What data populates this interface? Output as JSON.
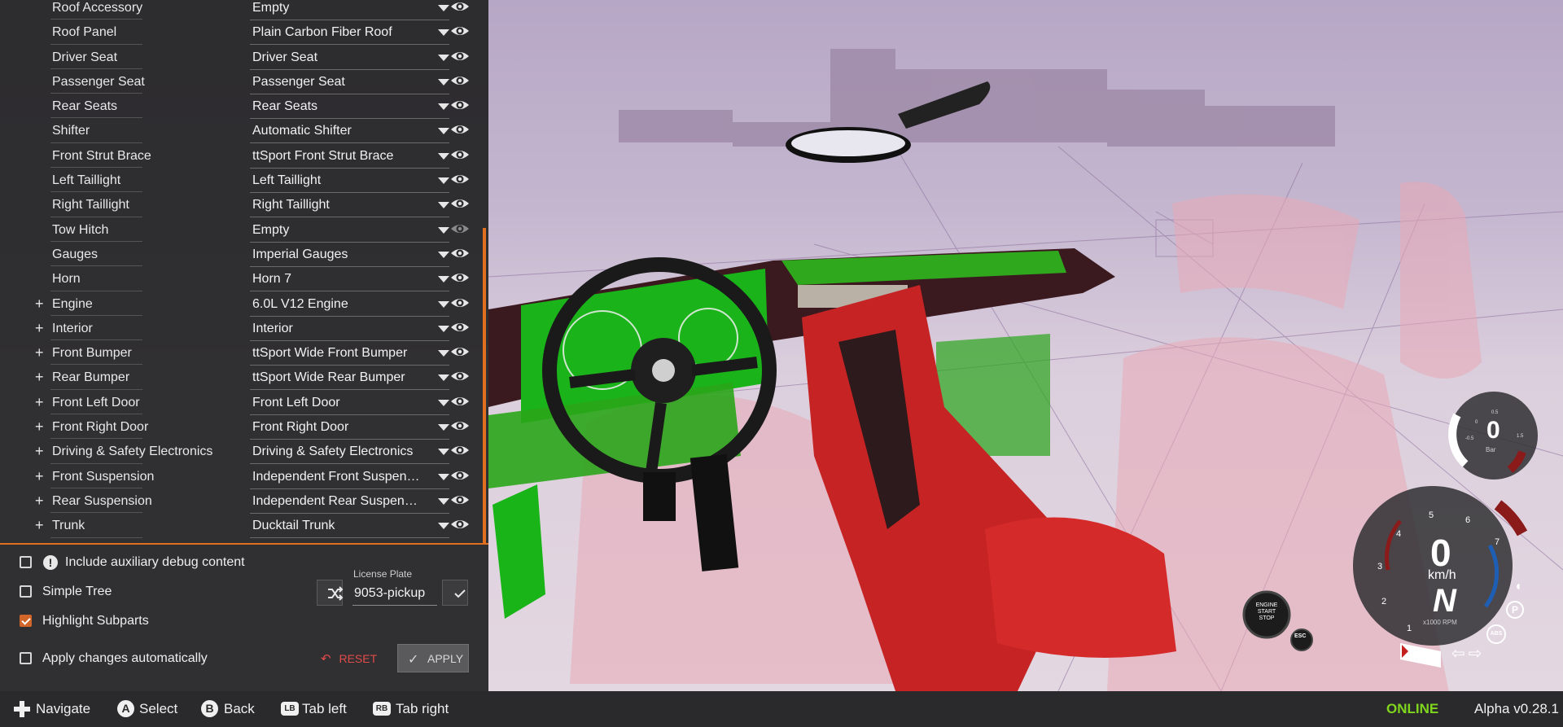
{
  "parts": [
    {
      "name": "Roof Accessory",
      "value": "Empty",
      "expandable": false,
      "visible": true
    },
    {
      "name": "Roof Panel",
      "value": "Plain Carbon Fiber Roof",
      "expandable": false,
      "visible": true
    },
    {
      "name": "Driver Seat",
      "value": "Driver Seat",
      "expandable": false,
      "visible": true
    },
    {
      "name": "Passenger Seat",
      "value": "Passenger Seat",
      "expandable": false,
      "visible": true
    },
    {
      "name": "Rear Seats",
      "value": "Rear Seats",
      "expandable": false,
      "visible": true
    },
    {
      "name": "Shifter",
      "value": "Automatic Shifter",
      "expandable": false,
      "visible": true
    },
    {
      "name": "Front Strut Brace",
      "value": "ttSport Front Strut Brace",
      "expandable": false,
      "visible": true
    },
    {
      "name": "Left Taillight",
      "value": "Left Taillight",
      "expandable": false,
      "visible": true
    },
    {
      "name": "Right Taillight",
      "value": "Right Taillight",
      "expandable": false,
      "visible": true
    },
    {
      "name": "Tow Hitch",
      "value": "Empty",
      "expandable": false,
      "visible": false
    },
    {
      "name": "Gauges",
      "value": "Imperial Gauges",
      "expandable": false,
      "visible": true
    },
    {
      "name": "Horn",
      "value": "Horn 7",
      "expandable": false,
      "visible": true
    },
    {
      "name": "Engine",
      "value": "6.0L V12 Engine",
      "expandable": true,
      "visible": true
    },
    {
      "name": "Interior",
      "value": "Interior",
      "expandable": true,
      "visible": true
    },
    {
      "name": "Front Bumper",
      "value": "ttSport Wide Front Bumper",
      "expandable": true,
      "visible": true
    },
    {
      "name": "Rear Bumper",
      "value": "ttSport Wide Rear Bumper",
      "expandable": true,
      "visible": true
    },
    {
      "name": "Front Left Door",
      "value": "Front Left Door",
      "expandable": true,
      "visible": true
    },
    {
      "name": "Front Right Door",
      "value": "Front Right Door",
      "expandable": true,
      "visible": true
    },
    {
      "name": "Driving & Safety Electronics",
      "value": "Driving & Safety Electronics",
      "expandable": true,
      "visible": true
    },
    {
      "name": "Front Suspension",
      "value": "Independent Front Suspension",
      "expandable": true,
      "visible": true
    },
    {
      "name": "Rear Suspension",
      "value": "Independent Rear Suspension",
      "expandable": true,
      "visible": true
    },
    {
      "name": "Trunk",
      "value": "Ducktail Trunk",
      "expandable": true,
      "visible": true
    }
  ],
  "options": {
    "debug": {
      "label": "Include auxiliary debug content",
      "checked": false
    },
    "simple_tree": {
      "label": "Simple Tree",
      "checked": false
    },
    "highlight": {
      "label": "Highlight Subparts",
      "checked": true
    },
    "auto_apply": {
      "label": "Apply changes automatically",
      "checked": false
    }
  },
  "license_plate": {
    "label": "License Plate",
    "value": "9053-pickup"
  },
  "buttons": {
    "reset": "RESET",
    "apply": "APPLY"
  },
  "hints": {
    "navigate": "Navigate",
    "select_glyph": "A",
    "select": "Select",
    "back_glyph": "B",
    "back": "Back",
    "tab_left_glyph": "LB",
    "tab_left": "Tab left",
    "tab_right_glyph": "RB",
    "tab_right": "Tab right"
  },
  "status": {
    "online": "ONLINE",
    "version": "Alpha v0.28.1"
  },
  "hud": {
    "speed": "0",
    "speed_unit": "km/h",
    "gear": "N",
    "rpm_unit": "x1000 RPM",
    "rpm_ticks": [
      "1",
      "2",
      "3",
      "4",
      "5",
      "6",
      "7"
    ],
    "boost_value": "0",
    "boost_unit": "Bar",
    "boost_ticks": [
      "-0.5",
      "0",
      "0.5",
      "1.5"
    ],
    "engine_button": "ENGINE\nSTART\nSTOP",
    "esc_label": "ESC",
    "abs_label": "ABS",
    "park_label": "P"
  },
  "colors": {
    "accent": "#e0701f",
    "online": "#7fd61d",
    "reset": "#e24b4b"
  }
}
